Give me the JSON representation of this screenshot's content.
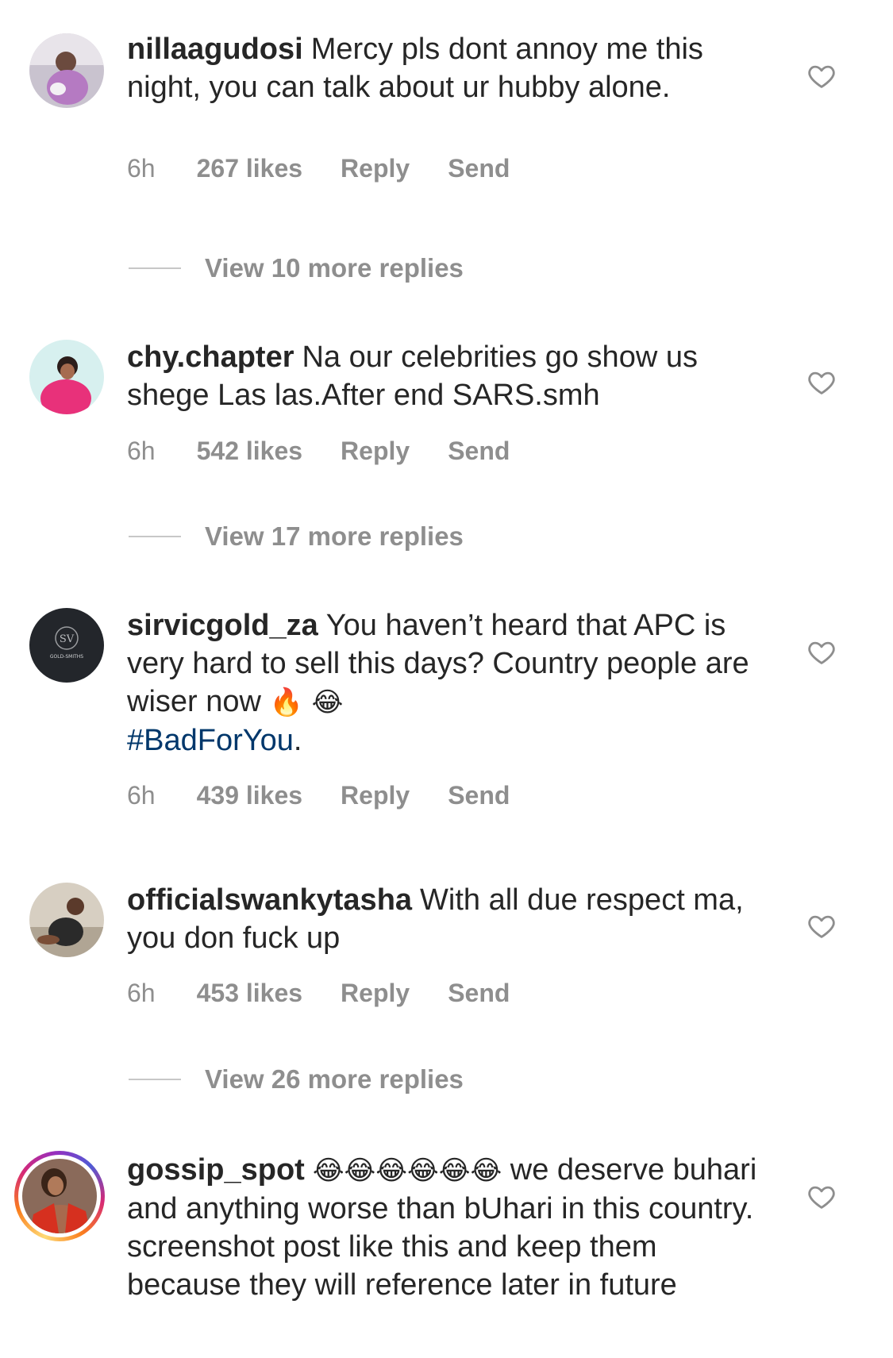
{
  "colors": {
    "meta": "#8e8e8e",
    "hashtag": "#00376b",
    "text": "#262626"
  },
  "comments": [
    {
      "username": "nillaagudosi",
      "text": "Mercy pls dont annoy me this night, you can talk about ur hubby alone.",
      "time": "6h",
      "likes": "267 likes",
      "reply": "Reply",
      "send": "Send",
      "view_replies": "View 10 more replies"
    },
    {
      "username": "chy.chapter",
      "text": "Na our celebrities go show us shege Las las.After end SARS.smh",
      "time": "6h",
      "likes": "542 likes",
      "reply": "Reply",
      "send": "Send",
      "view_replies": "View 17 more replies"
    },
    {
      "username": "sirvicgold_za",
      "text": "You haven’t heard that APC is very hard to sell this days? Country people are wiser now",
      "emoji": "🔥 😂",
      "hashtag": "#BadForYou",
      "hashtag_suffix": ".",
      "time": "6h",
      "likes": "439 likes",
      "reply": "Reply",
      "send": "Send",
      "avatar_logo": "GOLD-SMITHS"
    },
    {
      "username": "officialswankytasha",
      "text": "With all due respect ma, you don fuck up",
      "time": "6h",
      "likes": "453 likes",
      "reply": "Reply",
      "send": "Send",
      "view_replies": "View 26 more replies"
    },
    {
      "username": "gossip_spot",
      "emoji": "😂😂😂😂😂😂",
      "text": "we deserve buhari and anything worse than bUhari in this country. screenshot post like this and keep them because they will reference later in future"
    }
  ],
  "icons": {
    "like": "heart-outline-icon"
  }
}
